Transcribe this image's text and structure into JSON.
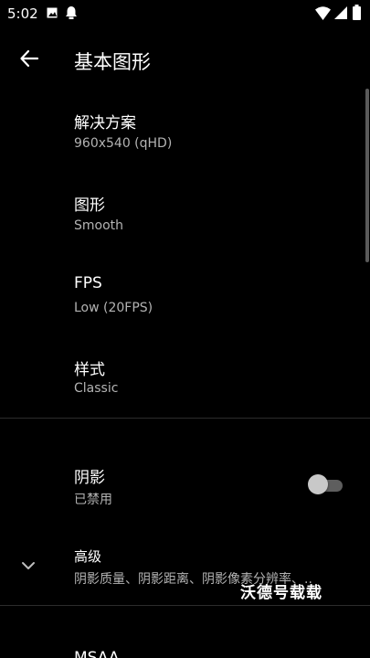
{
  "status_bar": {
    "time": "5:02",
    "icons": [
      "gallery-icon",
      "notification-icon",
      "wifi-icon",
      "signal-icon",
      "battery-icon"
    ]
  },
  "toolbar": {
    "back_icon": "arrow-left-icon",
    "title": "基本图形"
  },
  "preferences": [
    {
      "title": "解决方案",
      "summary": "960x540 (qHD)"
    },
    {
      "title": "图形",
      "summary": "Smooth"
    },
    {
      "title": "FPS",
      "summary": "Low (20FPS)"
    },
    {
      "title": "样式",
      "summary": "Classic"
    }
  ],
  "shadow": {
    "title": "阴影",
    "summary": "已禁用",
    "enabled": false
  },
  "advanced": {
    "title": "高级",
    "summary": "阴影质量、阴影距离、阴影像素分辨率、..",
    "icon": "chevron-down-icon"
  },
  "watermark": "沃德号载载",
  "next_item_partial": "MSAA",
  "colors": {
    "background": "#000000",
    "text_primary": "#ffffff",
    "text_secondary": "#b3b3b3",
    "divider": "#2c2c2c"
  }
}
